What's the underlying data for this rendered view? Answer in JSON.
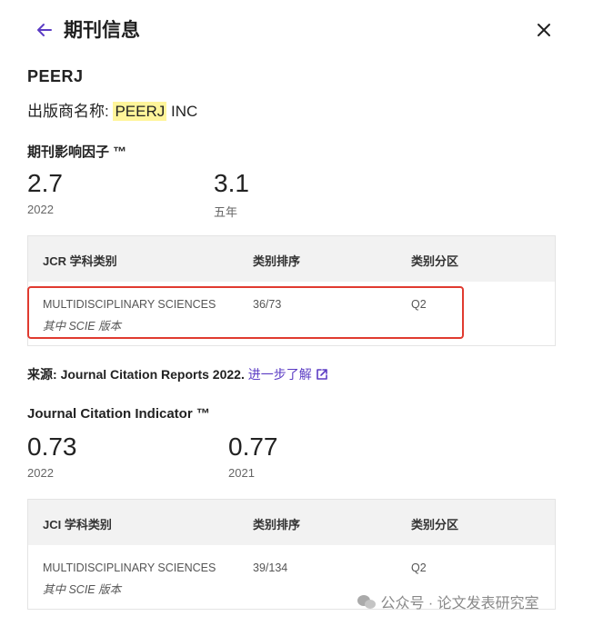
{
  "header": {
    "title": "期刊信息"
  },
  "journal": {
    "name": "PEERJ"
  },
  "publisher": {
    "label": "出版商名称: ",
    "name_highlight": "PEERJ",
    "name_rest": " INC"
  },
  "jif": {
    "title": "期刊影响因子 ™",
    "values": [
      {
        "value": "2.7",
        "label": "2022"
      },
      {
        "value": "3.1",
        "label": "五年"
      }
    ],
    "table": {
      "headers": [
        "JCR 学科类别",
        "类别排序",
        "类别分区"
      ],
      "rows": [
        {
          "category": "MULTIDISCIPLINARY SCIENCES",
          "edition": "其中 SCIE 版本",
          "rank": "36/73",
          "quartile": "Q2"
        }
      ]
    }
  },
  "source": {
    "label": "来源: ",
    "text": "Journal Citation Reports  2022. ",
    "link": "进一步了解"
  },
  "jci": {
    "title": "Journal Citation Indicator ™",
    "values": [
      {
        "value": "0.73",
        "label": "2022"
      },
      {
        "value": "0.77",
        "label": "2021"
      }
    ],
    "table": {
      "headers": [
        "JCI 学科类别",
        "类别排序",
        "类别分区"
      ],
      "rows": [
        {
          "category": "MULTIDISCIPLINARY SCIENCES",
          "edition": "其中 SCIE 版本",
          "rank": "39/134",
          "quartile": "Q2"
        }
      ]
    }
  },
  "watermark": {
    "text": "公众号 · 论文发表研究室"
  },
  "colors": {
    "accent": "#5b3cc4",
    "highlight": "#fff59a",
    "annotation_box": "#e03a2f"
  }
}
